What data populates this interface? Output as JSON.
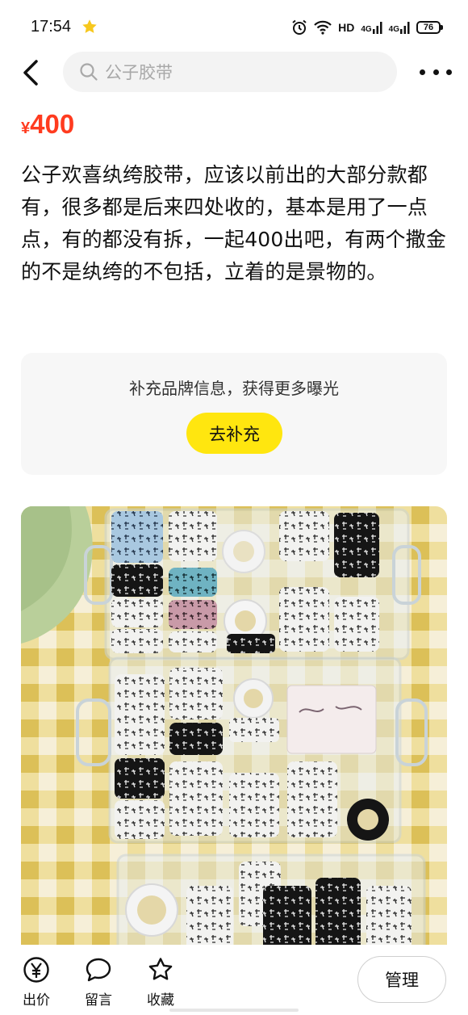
{
  "status_bar": {
    "time": "17:54",
    "network_label": "HD",
    "signal_1": "4G",
    "signal_2": "4G",
    "battery": "76"
  },
  "nav": {
    "search_placeholder": "公子胶带"
  },
  "listing": {
    "currency_symbol": "¥",
    "price": "400",
    "description": "公子欢喜纨绔胶带，应该以前出的大部分款都有，很多都是后来四处收的，基本是用了一点点，有的都没有拆，一起400出吧，有两个撒金的不是纨绔的不包括，立着的是景物的。"
  },
  "brand_prompt": {
    "text": "补充品牌信息，获得更多曝光",
    "button_label": "去补充",
    "button_color": "#ffe60f"
  },
  "bottom_bar": {
    "bid_label": "出价",
    "comment_label": "留言",
    "favorite_label": "收藏",
    "manage_label": "管理"
  },
  "colors": {
    "price": "#ff3b1f",
    "accent_yellow": "#ffe60f",
    "card_bg": "#f7f7f7"
  }
}
